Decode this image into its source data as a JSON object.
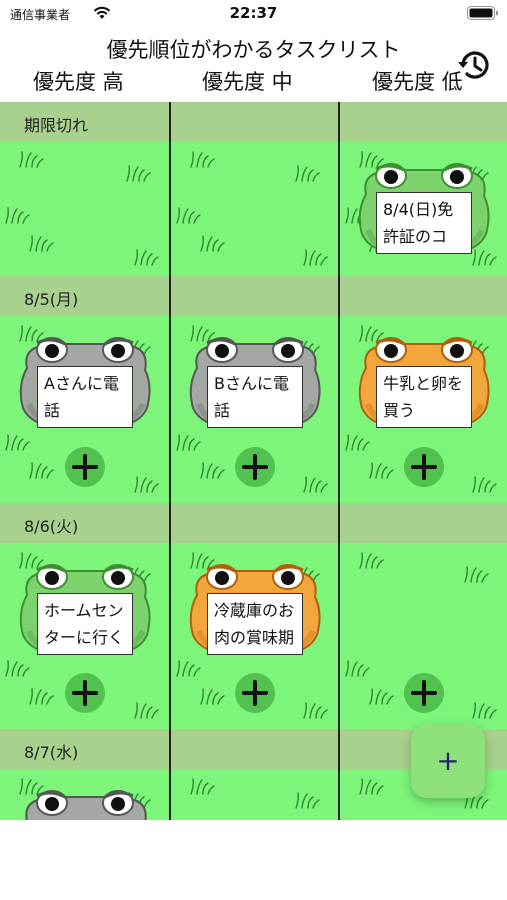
{
  "status_bar": {
    "carrier": "通信事業者",
    "time": "22:37"
  },
  "header": {
    "title": "優先順位がわかるタスクリスト",
    "columns": [
      "優先度 高",
      "優先度 中",
      "優先度 低"
    ]
  },
  "sections": [
    {
      "label": "期限切れ",
      "tasks": [
        null,
        null,
        {
          "text": "8/4(日)免許証のコ",
          "color": "green"
        }
      ]
    },
    {
      "label": "8/5(月)",
      "tasks": [
        {
          "text": "Aさんに電話",
          "color": "gray"
        },
        {
          "text": "Bさんに電話",
          "color": "gray"
        },
        {
          "text": "牛乳と卵を買う",
          "color": "orange"
        }
      ]
    },
    {
      "label": "8/6(火)",
      "tasks": [
        {
          "text": "ホームセンターに行く",
          "color": "green"
        },
        {
          "text": "冷蔵庫のお肉の賞味期",
          "color": "orange"
        },
        null
      ]
    },
    {
      "label": "8/7(水)",
      "tasks": [
        {
          "text": "",
          "color": "gray"
        },
        null,
        null
      ]
    }
  ],
  "add_label": "+",
  "fab_label": "+",
  "icons": {
    "history": "history-icon",
    "wifi": "wifi-icon",
    "battery": "battery-icon",
    "add": "plus-icon"
  },
  "colors": {
    "grass": "#7cf57a",
    "section_header": "#a9d18e",
    "frog_green": "#7cd36b",
    "frog_gray": "#9aa09a",
    "frog_orange": "#f0a23a"
  }
}
